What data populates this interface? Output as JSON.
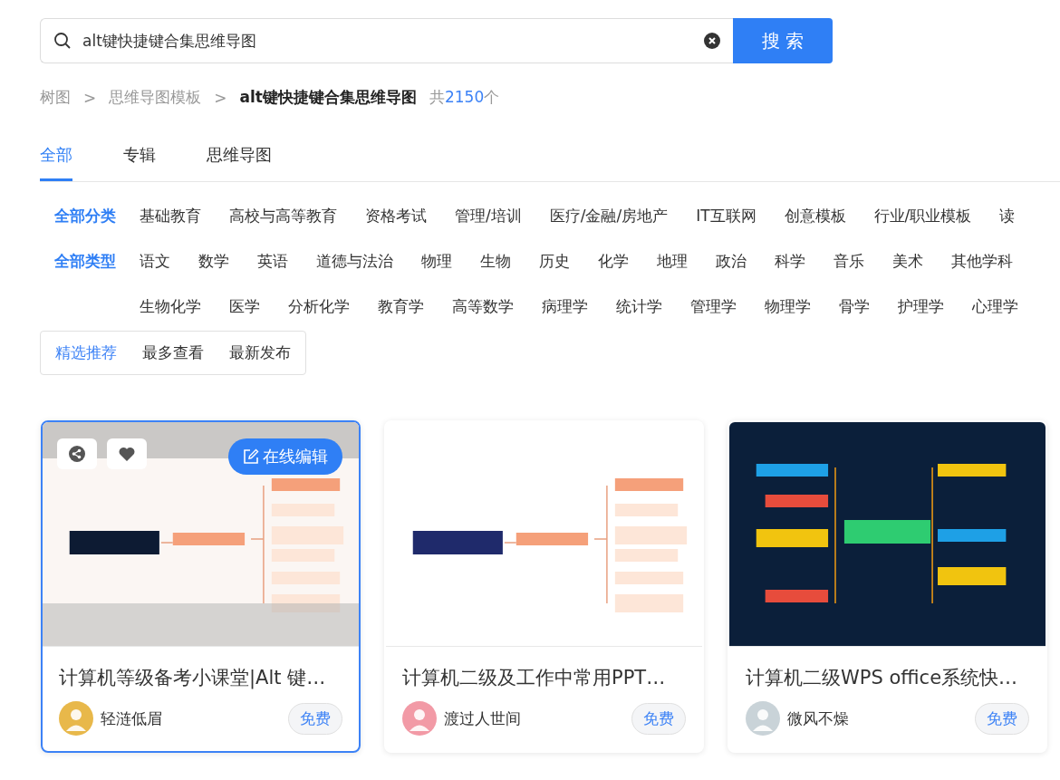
{
  "search": {
    "value": "alt键快捷键合集思维导图",
    "button": "搜 索"
  },
  "breadcrumb": {
    "items": [
      "树图",
      "思维导图模板"
    ],
    "separator": ">",
    "current": "alt键快捷键合集思维导图",
    "count_prefix": "共",
    "count": "2150",
    "count_suffix": "个"
  },
  "tabs": [
    {
      "label": "全部",
      "selected": true
    },
    {
      "label": "专辑",
      "selected": false
    },
    {
      "label": "思维导图",
      "selected": false
    }
  ],
  "filters": [
    {
      "label": "全部分类",
      "items": [
        "基础教育",
        "高校与高等教育",
        "资格考试",
        "管理/培训",
        "医疗/金融/房地产",
        "IT互联网",
        "创意模板",
        "行业/职业模板",
        "读"
      ]
    },
    {
      "label": "全部类型",
      "items": [
        "语文",
        "数学",
        "英语",
        "道德与法治",
        "物理",
        "生物",
        "历史",
        "化学",
        "地理",
        "政治",
        "科学",
        "音乐",
        "美术",
        "其他学科",
        "生物化学",
        "医学",
        "分析化学",
        "教育学",
        "高等数学",
        "病理学",
        "统计学",
        "管理学",
        "物理学",
        "骨学",
        "护理学",
        "心理学"
      ]
    }
  ],
  "sort": [
    {
      "label": "精选推荐",
      "selected": true
    },
    {
      "label": "最多查看",
      "selected": false
    },
    {
      "label": "最新发布",
      "selected": false
    }
  ],
  "cards": [
    {
      "title": "计算机等级备考小课堂|Alt 键…",
      "author": "轻涟低眉",
      "badge": "免费",
      "selected": true,
      "edit_button": "在线编辑"
    },
    {
      "title": "计算机二级及工作中常用PPT…",
      "author": "渡过人世间",
      "badge": "免费",
      "selected": false
    },
    {
      "title": "计算机二级WPS office系统快…",
      "author": "微风不燥",
      "badge": "免费",
      "selected": false
    }
  ]
}
